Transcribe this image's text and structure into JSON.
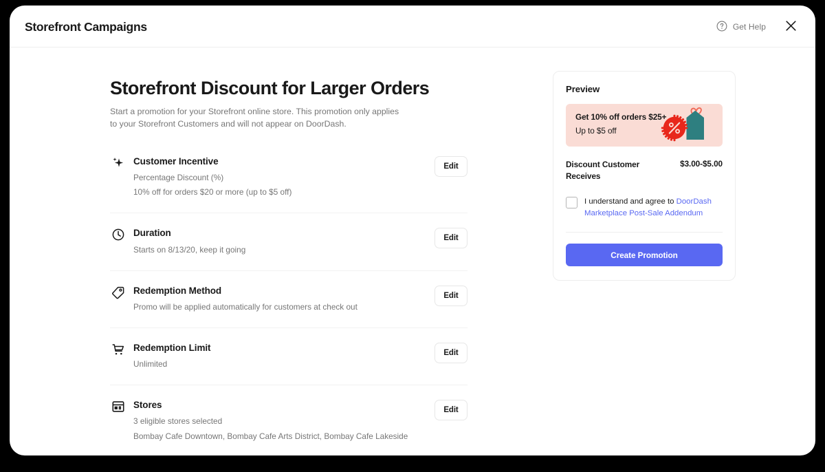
{
  "header": {
    "title": "Storefront Campaigns",
    "help_label": "Get Help",
    "help_icon": "question-circle-icon",
    "close_icon": "close-icon"
  },
  "main": {
    "title": "Storefront Discount for Larger Orders",
    "subtitle": "Start a promotion for your Storefront online store. This promotion only applies to your Storefront Customers and will not appear on DoorDash.",
    "edit_label": "Edit",
    "settings": [
      {
        "icon": "sparkle-icon",
        "title": "Customer Incentive",
        "desc_lines": [
          "Percentage Discount (%)",
          "10% off for orders $20 or more (up to $5 off)"
        ]
      },
      {
        "icon": "clock-icon",
        "title": "Duration",
        "desc_lines": [
          "Starts on 8/13/20, keep it going"
        ]
      },
      {
        "icon": "tag-icon",
        "title": "Redemption Method",
        "desc_lines": [
          "Promo will be applied automatically for customers at check out"
        ]
      },
      {
        "icon": "shopping-cart-icon",
        "title": "Redemption Limit",
        "desc_lines": [
          "Unlimited"
        ]
      },
      {
        "icon": "storefront-icon",
        "title": "Stores",
        "desc_lines": [
          "3 eligible stores selected",
          "Bombay Cafe Downtown, Bombay Cafe Arts District, Bombay Cafe Lakeside"
        ]
      }
    ]
  },
  "preview": {
    "heading": "Preview",
    "banner": {
      "line1": "Get 10% off orders $25+",
      "line2": "Up to $5 off",
      "background_color": "#fadcd5",
      "art_icon": "price-tag-percent-icon"
    },
    "discount": {
      "label": "Discount Customer Receives",
      "value": "$3.00-$5.00"
    },
    "agreement": {
      "checked": false,
      "text_prefix": "I understand and agree to ",
      "link_text": "DoorDash Marketplace Post-Sale Addendum",
      "link_color": "#5968f2"
    },
    "create_button": {
      "label": "Create Promotion",
      "color": "#5968f2"
    }
  }
}
